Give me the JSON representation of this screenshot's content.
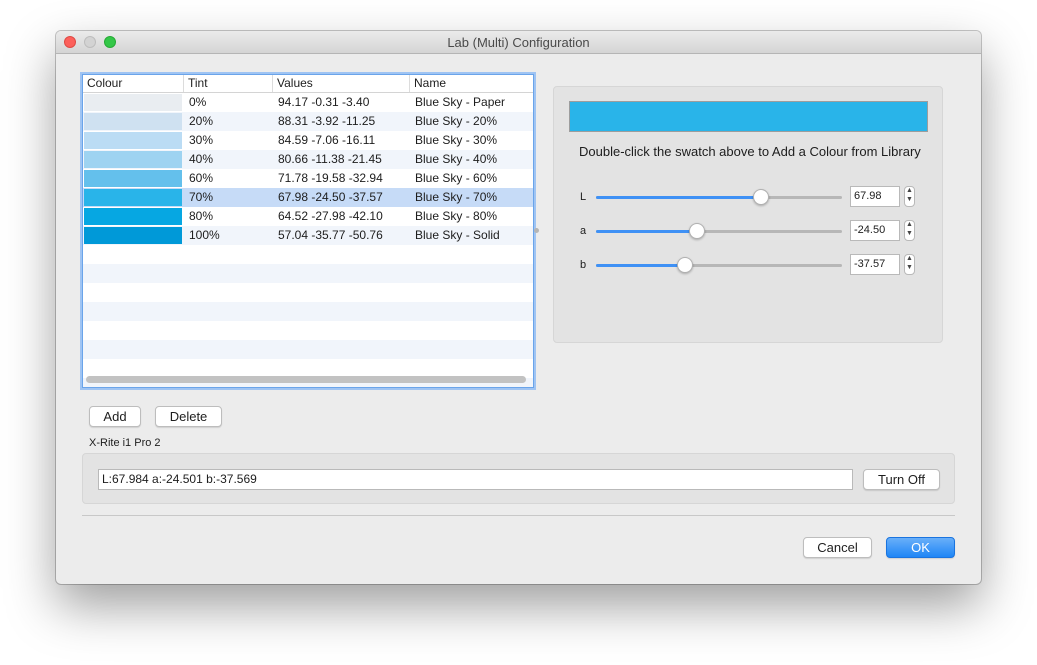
{
  "window": {
    "title": "Lab (Multi) Configuration"
  },
  "table": {
    "columns": [
      "Colour",
      "Tint",
      "Values",
      "Name"
    ],
    "rows": [
      {
        "color": "#e9edf1",
        "tint": "0%",
        "values": "94.17 -0.31 -3.40",
        "name": "Blue Sky - Paper"
      },
      {
        "color": "#cfe1f1",
        "tint": "20%",
        "values": "88.31 -3.92 -11.25",
        "name": "Blue Sky - 20%"
      },
      {
        "color": "#bbdcf4",
        "tint": "30%",
        "values": "84.59 -7.06 -16.11",
        "name": "Blue Sky - 30%"
      },
      {
        "color": "#9ed3f1",
        "tint": "40%",
        "values": "80.66 -11.38 -21.45",
        "name": "Blue Sky - 40%"
      },
      {
        "color": "#64c0ec",
        "tint": "60%",
        "values": "71.78 -19.58 -32.94",
        "name": "Blue Sky - 60%"
      },
      {
        "color": "#29b4e9",
        "tint": "70%",
        "values": "67.98 -24.50 -37.57",
        "name": "Blue Sky - 70%"
      },
      {
        "color": "#06a7e2",
        "tint": "80%",
        "values": "64.52 -27.98 -42.10",
        "name": "Blue Sky - 80%"
      },
      {
        "color": "#0099d8",
        "tint": "100%",
        "values": "57.04 -35.77 -50.76",
        "name": "Blue Sky - Solid"
      }
    ],
    "selected_index": 5
  },
  "buttons": {
    "add": "Add",
    "delete": "Delete",
    "turn_off": "Turn Off",
    "cancel": "Cancel",
    "ok": "OK"
  },
  "device": {
    "label": "X-Rite i1 Pro 2",
    "reading": "L:67.984 a:-24.501 b:-37.569"
  },
  "editor": {
    "swatch_color": "#29b4e9",
    "hint": "Double-click the swatch above to Add a Colour from Library",
    "sliders": [
      {
        "label": "L",
        "value": "67.98",
        "fraction": 0.67
      },
      {
        "label": "a",
        "value": "-24.50",
        "fraction": 0.41
      },
      {
        "label": "b",
        "value": "-37.57",
        "fraction": 0.36
      }
    ]
  },
  "colors": {
    "selection": "#c6dbf7",
    "accent": "#1f86f6",
    "close": "#fc605b",
    "maximize": "#34c748"
  }
}
